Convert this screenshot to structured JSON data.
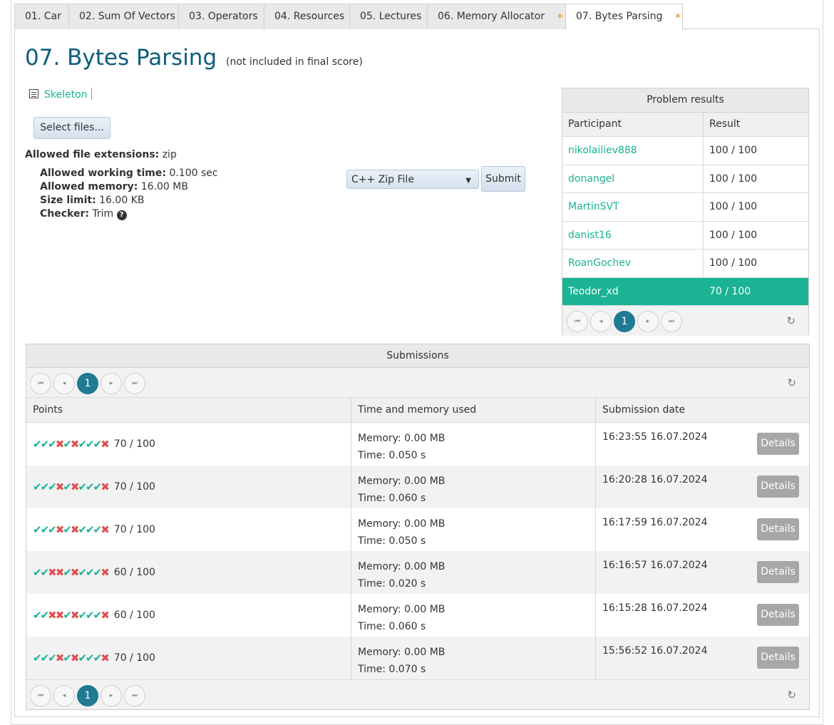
{
  "tabs": [
    {
      "label": "01. Car",
      "active": false,
      "starred": false
    },
    {
      "label": "02. Sum Of Vectors",
      "active": false,
      "starred": false
    },
    {
      "label": "03. Operators",
      "active": false,
      "starred": false
    },
    {
      "label": "04. Resources",
      "active": false,
      "starred": false
    },
    {
      "label": "05. Lectures",
      "active": false,
      "starred": false
    },
    {
      "label": "06. Memory Allocator",
      "active": false,
      "starred": true
    },
    {
      "label": "07. Bytes Parsing",
      "active": true,
      "starred": true
    }
  ],
  "tab_star": "✶",
  "problem": {
    "title": "07. Bytes Parsing",
    "subtitle": "(not included in final score)",
    "skeleton_label": "Skeleton",
    "select_files_label": "Select files...",
    "allowed_ext_label": "Allowed file extensions:",
    "allowed_ext_value": "zip",
    "working_time_label": "Allowed working time:",
    "working_time_value": "0.100 sec",
    "memory_label": "Allowed memory:",
    "memory_value": "16.00 MB",
    "size_label": "Size limit:",
    "size_value": "16.00 KB",
    "checker_label": "Checker:",
    "checker_value": "Trim",
    "language_selected": "C++ Zip File",
    "submit_label": "Submit"
  },
  "results": {
    "title": "Problem results",
    "col_participant": "Participant",
    "col_result": "Result",
    "rows": [
      {
        "participant": "nikolailiev888",
        "result": "100 / 100",
        "me": false
      },
      {
        "participant": "donangel",
        "result": "100 / 100",
        "me": false
      },
      {
        "participant": "MartinSVT",
        "result": "100 / 100",
        "me": false
      },
      {
        "participant": "danist16",
        "result": "100 / 100",
        "me": false
      },
      {
        "participant": "RoanGochev",
        "result": "100 / 100",
        "me": false
      },
      {
        "participant": "Teodor_xd",
        "result": "70 / 100",
        "me": true
      }
    ],
    "page": "1"
  },
  "pager_glyphs": {
    "first": "⏮",
    "prev": "◂",
    "next": "▸",
    "last": "⏭",
    "refresh": "↻"
  },
  "submissions": {
    "title": "Submissions",
    "page": "1",
    "col_points": "Points",
    "col_time_memory": "Time and memory used",
    "col_date": "Submission date",
    "details_label": "Details",
    "rows": [
      {
        "tests": [
          1,
          1,
          1,
          0,
          1,
          0,
          1,
          1,
          1,
          0
        ],
        "points": "70 / 100",
        "memory": "Memory: 0.00 MB",
        "time": "Time: 0.050 s",
        "date": "16:23:55 16.07.2024"
      },
      {
        "tests": [
          1,
          1,
          1,
          0,
          1,
          0,
          1,
          1,
          1,
          0
        ],
        "points": "70 / 100",
        "memory": "Memory: 0.00 MB",
        "time": "Time: 0.060 s",
        "date": "16:20:28 16.07.2024"
      },
      {
        "tests": [
          1,
          1,
          1,
          0,
          1,
          0,
          1,
          1,
          1,
          0
        ],
        "points": "70 / 100",
        "memory": "Memory: 0.00 MB",
        "time": "Time: 0.050 s",
        "date": "16:17:59 16.07.2024"
      },
      {
        "tests": [
          1,
          1,
          0,
          0,
          1,
          0,
          1,
          1,
          1,
          0
        ],
        "points": "60 / 100",
        "memory": "Memory: 0.00 MB",
        "time": "Time: 0.020 s",
        "date": "16:16:57 16.07.2024"
      },
      {
        "tests": [
          1,
          1,
          0,
          0,
          1,
          0,
          1,
          1,
          1,
          0
        ],
        "points": "60 / 100",
        "memory": "Memory: 0.00 MB",
        "time": "Time: 0.060 s",
        "date": "16:15:28 16.07.2024"
      },
      {
        "tests": [
          1,
          1,
          1,
          0,
          1,
          0,
          1,
          1,
          1,
          0
        ],
        "points": "70 / 100",
        "memory": "Memory: 0.00 MB",
        "time": "Time: 0.070 s",
        "date": "15:56:52 16.07.2024"
      }
    ]
  },
  "colors": {
    "accent": "#1ab394",
    "title": "#0d5d7c",
    "fail": "#e05050",
    "page_current": "#1f7a93"
  }
}
